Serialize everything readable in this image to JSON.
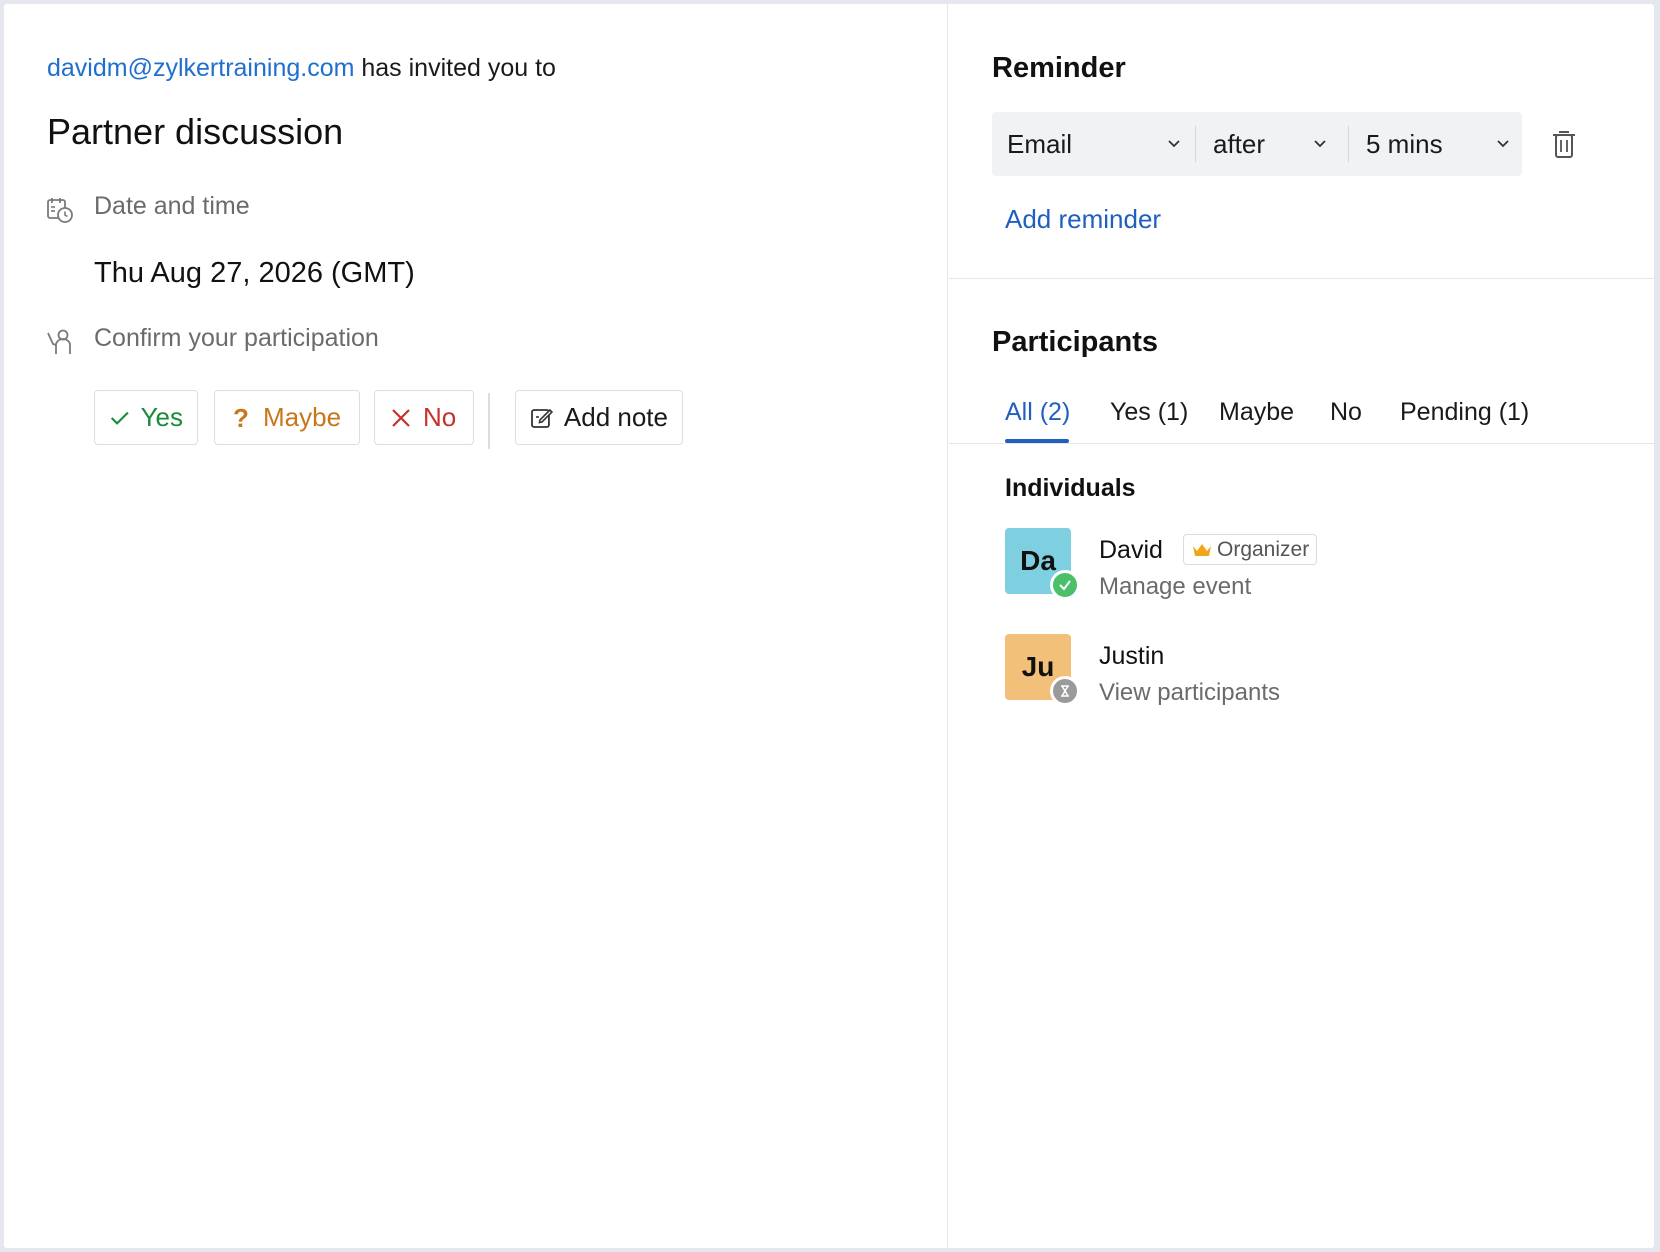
{
  "invite": {
    "sender_email": "davidm@zylkertraining.com",
    "invite_text": "has invited you to",
    "event_title": "Partner discussion"
  },
  "date_section": {
    "label": "Date and time",
    "value": "Thu Aug 27, 2026 (GMT)",
    "icon": "calendar-clock-icon"
  },
  "participation": {
    "label": "Confirm your participation",
    "icon": "person-raise-hand-icon",
    "buttons": {
      "yes": "Yes",
      "maybe": "Maybe",
      "no": "No",
      "add_note": "Add note"
    },
    "colors": {
      "yes": "#1c8a3a",
      "maybe": "#c8771b",
      "no": "#c4322b"
    }
  },
  "reminder": {
    "heading": "Reminder",
    "type": "Email",
    "timing": "after",
    "duration": "5 mins",
    "add_label": "Add reminder"
  },
  "participants": {
    "heading": "Participants",
    "tabs": [
      {
        "label": "All (2)",
        "active": true
      },
      {
        "label": "Yes (1)",
        "active": false
      },
      {
        "label": "Maybe",
        "active": false
      },
      {
        "label": "No",
        "active": false
      },
      {
        "label": "Pending (1)",
        "active": false
      }
    ],
    "group_label": "Individuals",
    "people": [
      {
        "initials": "Da",
        "name": "David",
        "role_link": "Manage event",
        "badge": "Organizer",
        "status": "accepted",
        "avatar_color": "#7ecfe0"
      },
      {
        "initials": "Ju",
        "name": "Justin",
        "role_link": "View participants",
        "status": "pending",
        "avatar_color": "#f3c07a"
      }
    ]
  },
  "accent_color": "#1f5fbf"
}
